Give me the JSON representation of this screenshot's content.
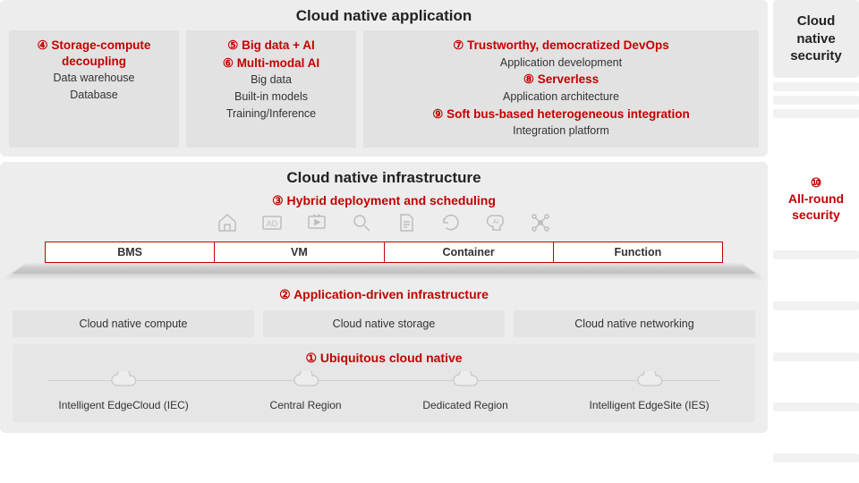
{
  "app": {
    "title": "Cloud native application",
    "col1": {
      "num": "④",
      "head": "Storage-compute decoupling",
      "sub1": "Data warehouse",
      "sub2": "Database"
    },
    "col2": {
      "num5": "⑤",
      "head5": "Big data + AI",
      "num6": "⑥",
      "head6": "Multi-modal AI",
      "sub1": "Big data",
      "sub2": "Built-in models",
      "sub3": "Training/Inference"
    },
    "col3": {
      "num7": "⑦",
      "head7": "Trustworthy, democratized DevOps",
      "sub7": "Application development",
      "num8": "⑧",
      "head8": "Serverless",
      "sub8": "Application architecture",
      "num9": "⑨",
      "head9": "Soft bus-based heterogeneous integration",
      "sub9": "Integration platform"
    }
  },
  "infra": {
    "title": "Cloud native infrastructure",
    "hybrid": {
      "num": "③",
      "head": "Hybrid deployment and scheduling"
    },
    "compute": {
      "bms": "BMS",
      "vm": "VM",
      "container": "Container",
      "func": "Function"
    },
    "appdriven": {
      "num": "②",
      "head": "Application-driven infrastructure"
    },
    "tiles": {
      "compute": "Cloud native compute",
      "storage": "Cloud native storage",
      "networking": "Cloud native networking"
    },
    "ubiq": {
      "num": "①",
      "head": "Ubiquitous cloud native"
    },
    "clouds": {
      "iec": "Intelligent EdgeCloud (IEC)",
      "central": "Central Region",
      "dedicated": "Dedicated Region",
      "ies": "Intelligent EdgeSite (IES)"
    }
  },
  "side": {
    "top1": "Cloud",
    "top2": "native",
    "top3": "security",
    "num10": "⑩",
    "allround1": "All-round",
    "allround2": "security"
  },
  "icons": {
    "home": "home-icon",
    "ad": "ad-icon",
    "tv": "tv-play-icon",
    "search": "search-icon",
    "doc": "document-icon",
    "refresh": "refresh-icon",
    "ai": "ai-head-icon",
    "drone": "drone-icon",
    "cloud": "cloud-icon"
  }
}
